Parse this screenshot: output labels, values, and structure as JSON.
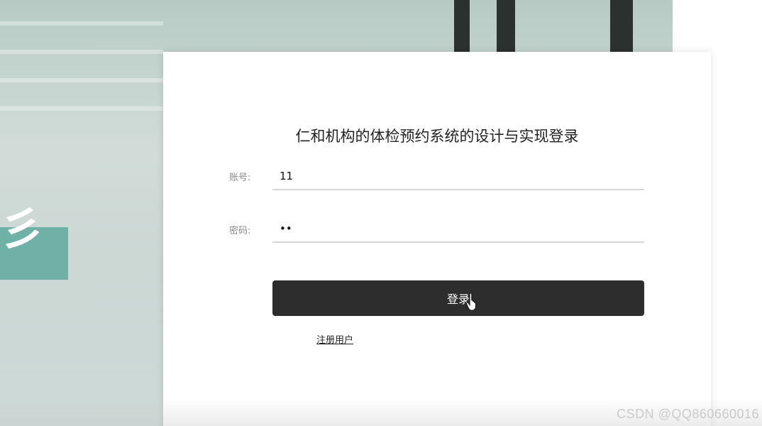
{
  "background": {
    "glyph": "彡"
  },
  "login": {
    "title": "仁和机构的体检预约系统的设计与实现登录",
    "account_label": "账号:",
    "account_value": "11",
    "password_label": "密码:",
    "password_value": "••",
    "login_button": "登录",
    "register_link": "注册用户"
  },
  "watermark": "CSDN @QQ860660016",
  "colors": {
    "button_bg": "#2d2d2d",
    "accent_teal": "#6fb0a7"
  },
  "icons": {
    "cursor": "hand-pointer-icon"
  }
}
